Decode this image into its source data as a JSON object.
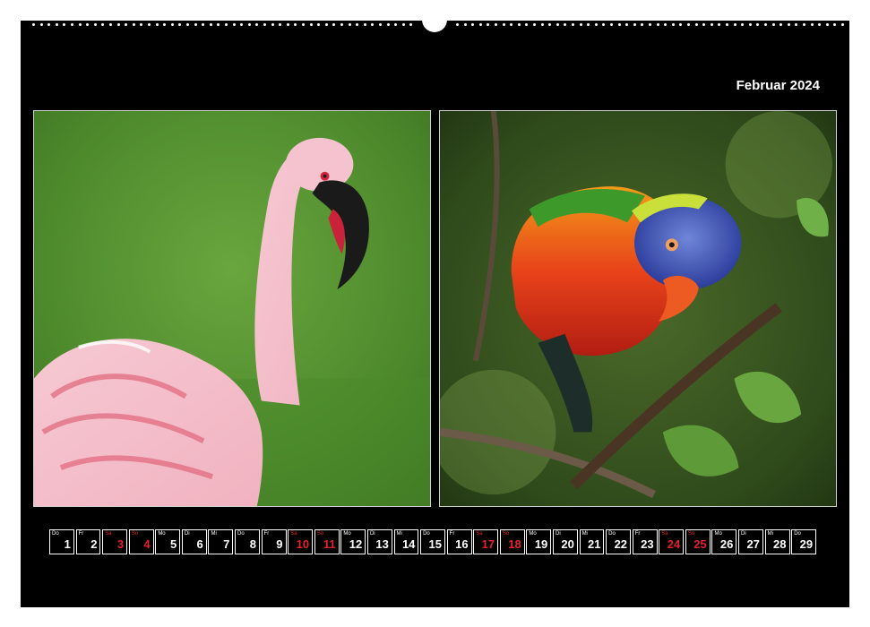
{
  "calendar": {
    "month_title": "Februar 2024",
    "accent_color": "#e3222a",
    "days": [
      {
        "wd": "Do",
        "num": "1",
        "weekend": false
      },
      {
        "wd": "Fr",
        "num": "2",
        "weekend": false
      },
      {
        "wd": "Sa",
        "num": "3",
        "weekend": true
      },
      {
        "wd": "So",
        "num": "4",
        "weekend": true
      },
      {
        "wd": "Mo",
        "num": "5",
        "weekend": false
      },
      {
        "wd": "Di",
        "num": "6",
        "weekend": false
      },
      {
        "wd": "Mi",
        "num": "7",
        "weekend": false
      },
      {
        "wd": "Do",
        "num": "8",
        "weekend": false
      },
      {
        "wd": "Fr",
        "num": "9",
        "weekend": false
      },
      {
        "wd": "Sa",
        "num": "10",
        "weekend": true
      },
      {
        "wd": "So",
        "num": "11",
        "weekend": true
      },
      {
        "wd": "Mo",
        "num": "12",
        "weekend": false
      },
      {
        "wd": "Di",
        "num": "13",
        "weekend": false
      },
      {
        "wd": "Mi",
        "num": "14",
        "weekend": false
      },
      {
        "wd": "Do",
        "num": "15",
        "weekend": false
      },
      {
        "wd": "Fr",
        "num": "16",
        "weekend": false
      },
      {
        "wd": "Sa",
        "num": "17",
        "weekend": true
      },
      {
        "wd": "So",
        "num": "18",
        "weekend": true
      },
      {
        "wd": "Mo",
        "num": "19",
        "weekend": false
      },
      {
        "wd": "Di",
        "num": "20",
        "weekend": false
      },
      {
        "wd": "Mi",
        "num": "21",
        "weekend": false
      },
      {
        "wd": "Do",
        "num": "22",
        "weekend": false
      },
      {
        "wd": "Fr",
        "num": "23",
        "weekend": false
      },
      {
        "wd": "Sa",
        "num": "24",
        "weekend": true
      },
      {
        "wd": "So",
        "num": "25",
        "weekend": true
      },
      {
        "wd": "Mo",
        "num": "26",
        "weekend": false
      },
      {
        "wd": "Di",
        "num": "27",
        "weekend": false
      },
      {
        "wd": "Mi",
        "num": "28",
        "weekend": false
      },
      {
        "wd": "Do",
        "num": "29",
        "weekend": false
      }
    ]
  },
  "photos": {
    "left_icon": "flamingo-photo",
    "right_icon": "rainbow-lorikeet-photo"
  }
}
